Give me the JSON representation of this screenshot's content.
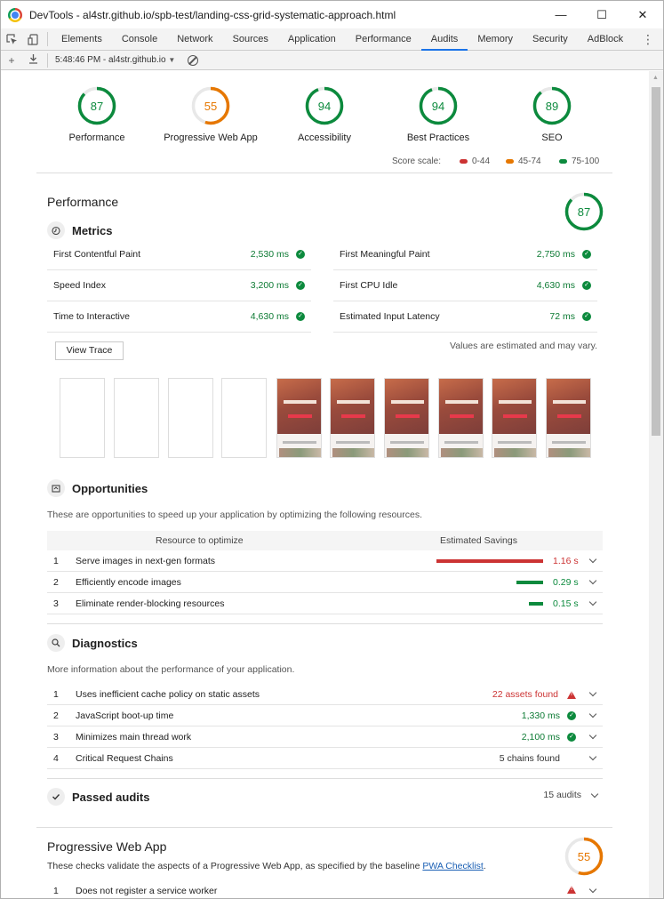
{
  "window": {
    "title": "DevTools - al4str.github.io/spb-test/landing-css-grid-systematic-approach.html",
    "minimize": "—",
    "maximize": "☐",
    "close": "✕"
  },
  "tabs": [
    "Elements",
    "Console",
    "Network",
    "Sources",
    "Application",
    "Performance",
    "Audits",
    "Memory",
    "Security",
    "AdBlock"
  ],
  "active_tab": "Audits",
  "toolbar": {
    "report_label": "5:48:46 PM - al4str.github.io"
  },
  "colors": {
    "pass": "#0c8a3d",
    "average": "#e67700",
    "fail": "#c33",
    "accent": "#1a73e8"
  },
  "gauges": [
    {
      "score": "87",
      "label": "Performance",
      "fraction": 0.87,
      "color": "#0c8a3d"
    },
    {
      "score": "55",
      "label": "Progressive Web App",
      "fraction": 0.55,
      "color": "#e67700"
    },
    {
      "score": "94",
      "label": "Accessibility",
      "fraction": 0.94,
      "color": "#0c8a3d"
    },
    {
      "score": "94",
      "label": "Best Practices",
      "fraction": 0.94,
      "color": "#0c8a3d"
    },
    {
      "score": "89",
      "label": "SEO",
      "fraction": 0.89,
      "color": "#0c8a3d"
    }
  ],
  "score_scale": {
    "label": "Score scale:",
    "items": [
      {
        "range": "0-44",
        "color": "#c33"
      },
      {
        "range": "45-74",
        "color": "#e67700"
      },
      {
        "range": "75-100",
        "color": "#0c8a3d"
      }
    ]
  },
  "performance": {
    "title": "Performance",
    "score": "87",
    "fraction": 0.87,
    "metrics_title": "Metrics",
    "metrics": [
      {
        "label": "First Contentful Paint",
        "value": "2,530 ms"
      },
      {
        "label": "First Meaningful Paint",
        "value": "2,750 ms"
      },
      {
        "label": "Speed Index",
        "value": "3,200 ms"
      },
      {
        "label": "First CPU Idle",
        "value": "4,630 ms"
      },
      {
        "label": "Time to Interactive",
        "value": "4,630 ms"
      },
      {
        "label": "Estimated Input Latency",
        "value": "72 ms"
      }
    ],
    "view_trace": "View Trace",
    "estimate_note": "Values are estimated and may vary.",
    "filmstrip_hero_text": "A WAVE TO THE HOLIDAY"
  },
  "opportunities": {
    "title": "Opportunities",
    "description": "These are opportunities to speed up your application by optimizing the following resources.",
    "col_resource": "Resource to optimize",
    "col_savings": "Estimated Savings",
    "rows": [
      {
        "num": "1",
        "text": "Serve images in next-gen formats",
        "savings": "1.16 s",
        "savings_value": 1.16,
        "color": "#c33"
      },
      {
        "num": "2",
        "text": "Efficiently encode images",
        "savings": "0.29 s",
        "savings_value": 0.29,
        "color": "#0c8a3d"
      },
      {
        "num": "3",
        "text": "Eliminate render-blocking resources",
        "savings": "0.15 s",
        "savings_value": 0.15,
        "color": "#0c8a3d"
      }
    ]
  },
  "diagnostics": {
    "title": "Diagnostics",
    "description": "More information about the performance of your application.",
    "rows": [
      {
        "num": "1",
        "text": "Uses inefficient cache policy on static assets",
        "value": "22 assets found",
        "status": "fail"
      },
      {
        "num": "2",
        "text": "JavaScript boot-up time",
        "value": "1,330 ms",
        "status": "pass"
      },
      {
        "num": "3",
        "text": "Minimizes main thread work",
        "value": "2,100 ms",
        "status": "pass"
      },
      {
        "num": "4",
        "text": "Critical Request Chains",
        "value": "5 chains found",
        "status": "info"
      }
    ]
  },
  "passed": {
    "title": "Passed audits",
    "count": "15 audits"
  },
  "pwa": {
    "title": "Progressive Web App",
    "score": "55",
    "fraction": 0.55,
    "description": "These checks validate the aspects of a Progressive Web App, as specified by the baseline ",
    "link": "PWA Checklist",
    "description_end": ".",
    "rows": [
      {
        "num": "1",
        "text": "Does not register a service worker"
      }
    ]
  }
}
